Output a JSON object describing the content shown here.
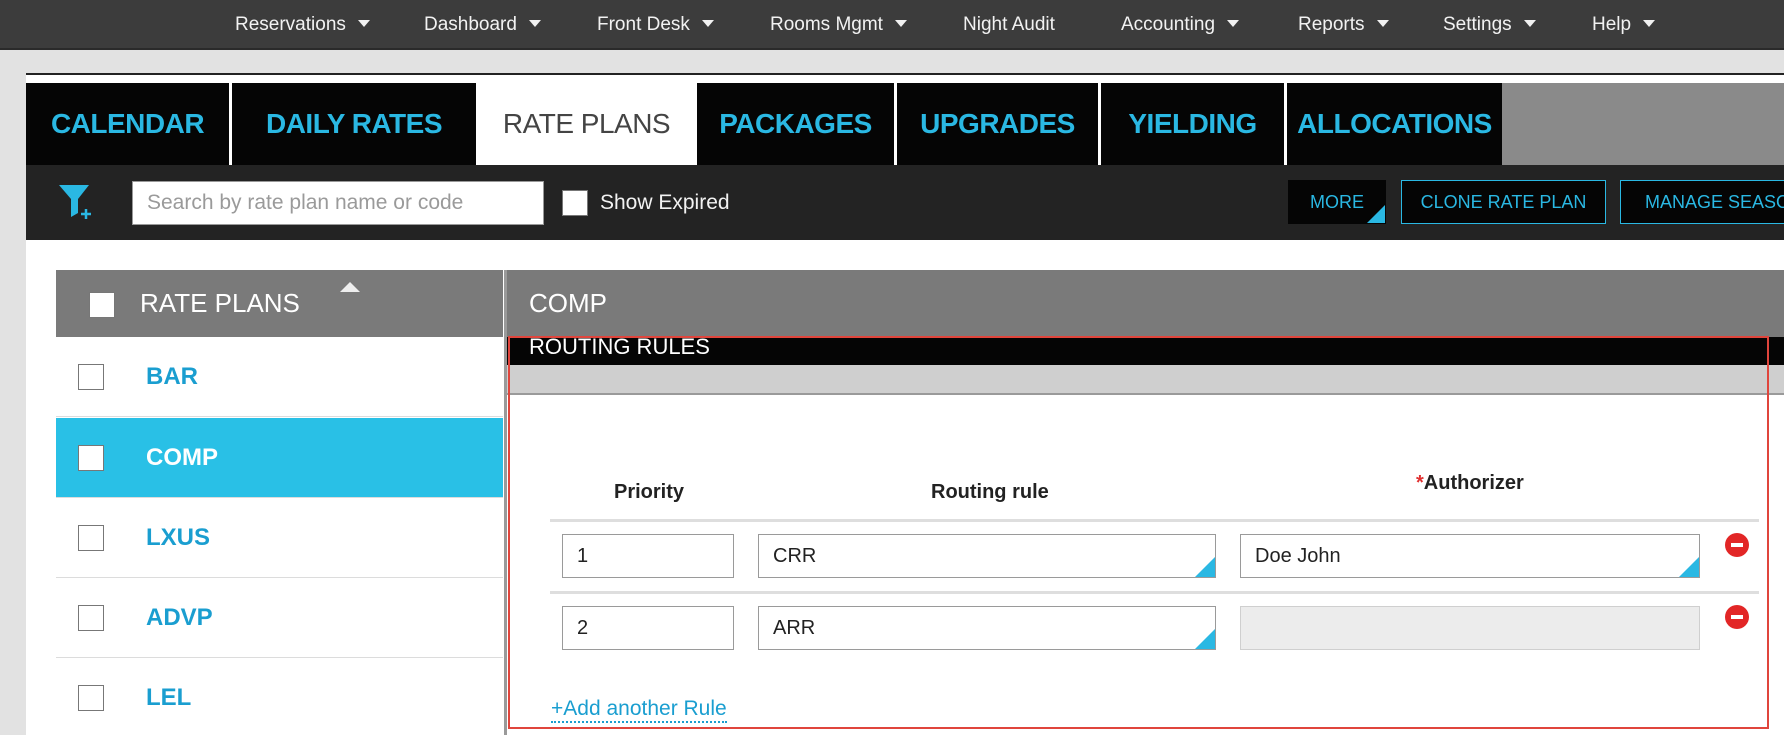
{
  "topnav": {
    "items": [
      {
        "label": "Reservations",
        "has_caret": true
      },
      {
        "label": "Dashboard",
        "has_caret": true
      },
      {
        "label": "Front Desk",
        "has_caret": true
      },
      {
        "label": "Rooms Mgmt",
        "has_caret": true
      },
      {
        "label": "Night Audit",
        "has_caret": false
      },
      {
        "label": "Accounting",
        "has_caret": true
      },
      {
        "label": "Reports",
        "has_caret": true
      },
      {
        "label": "Settings",
        "has_caret": true
      },
      {
        "label": "Help",
        "has_caret": true
      }
    ]
  },
  "tabs": [
    {
      "label": "CALENDAR",
      "active": false
    },
    {
      "label": "DAILY RATES",
      "active": false
    },
    {
      "label": "RATE PLANS",
      "active": true
    },
    {
      "label": "PACKAGES",
      "active": false
    },
    {
      "label": "UPGRADES",
      "active": false
    },
    {
      "label": "YIELDING",
      "active": false
    },
    {
      "label": "ALLOCATIONS",
      "active": false
    }
  ],
  "toolbar": {
    "filter_icon": "filter-plus-icon",
    "search_placeholder": "Search by rate plan name or code",
    "search_value": "",
    "show_expired_label": "Show Expired",
    "show_expired_checked": false,
    "more_label": "MORE",
    "clone_label": "CLONE RATE PLAN",
    "manage_label": "MANAGE SEASO"
  },
  "rate_plans": {
    "header": "RATE PLANS",
    "sort": "ascending",
    "items": [
      {
        "label": "BAR",
        "selected": false
      },
      {
        "label": "COMP",
        "selected": true
      },
      {
        "label": "LXUS",
        "selected": false
      },
      {
        "label": "ADVP",
        "selected": false
      },
      {
        "label": "LEL",
        "selected": false
      }
    ]
  },
  "detail": {
    "title": "COMP",
    "section_title": "ROUTING RULES",
    "columns": {
      "priority": "Priority",
      "routing_rule": "Routing rule",
      "authorizer_required": "*",
      "authorizer": "Authorizer"
    },
    "rules": [
      {
        "priority": "1",
        "routing_rule": "CRR",
        "authorizer": "Doe John"
      },
      {
        "priority": "2",
        "routing_rule": "ARR",
        "authorizer": ""
      }
    ],
    "add_rule_label": "+Add another Rule"
  },
  "colors": {
    "accent": "#2ab8e3",
    "selected_row": "#29c0e6",
    "remove": "#e22626",
    "highlight": "#e0453c"
  }
}
